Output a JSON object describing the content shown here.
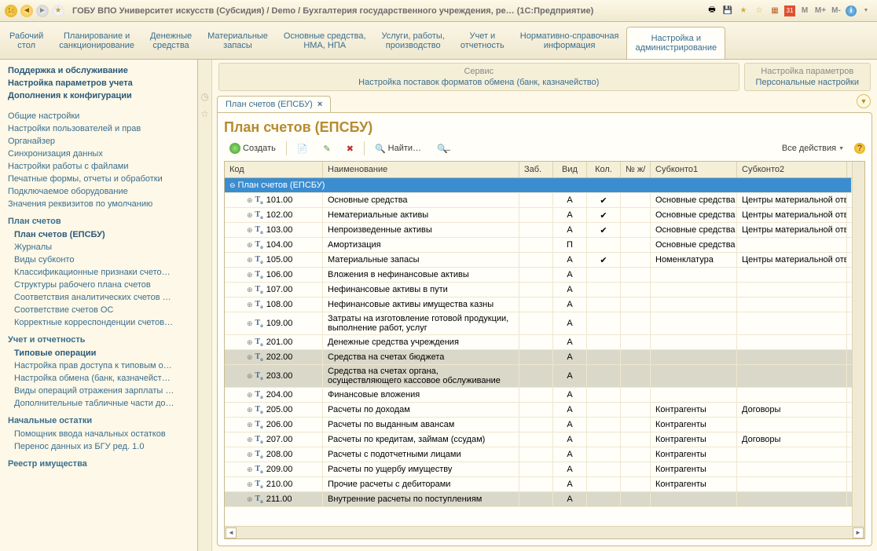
{
  "titlebar": {
    "text": "ГОБУ ВПО Университет искусств (Субсидия) / Demo / Бухгалтерия государственного учреждения, ре…   (1С:Предприятие)",
    "m_btns": [
      "M",
      "M+",
      "M-"
    ]
  },
  "main_tabs": [
    {
      "l1": "Рабочий",
      "l2": "стол"
    },
    {
      "l1": "Планирование и",
      "l2": "санкционирование"
    },
    {
      "l1": "Денежные",
      "l2": "средства"
    },
    {
      "l1": "Материальные",
      "l2": "запасы"
    },
    {
      "l1": "Основные средства,",
      "l2": "НМА, НПА"
    },
    {
      "l1": "Услуги, работы,",
      "l2": "производство"
    },
    {
      "l1": "Учет и",
      "l2": "отчетность"
    },
    {
      "l1": "Нормативно-справочная",
      "l2": "информация"
    },
    {
      "l1": "Настройка и",
      "l2": "администрирование",
      "active": true
    }
  ],
  "nav": {
    "groups": [
      {
        "title": null,
        "items": [
          {
            "t": "Поддержка и обслуживание",
            "bold": true,
            "plain": true
          },
          {
            "t": "Настройка параметров учета",
            "bold": true,
            "plain": true
          },
          {
            "t": "Дополнения к конфигурации",
            "bold": true,
            "plain": true
          }
        ]
      },
      {
        "title": null,
        "items": [
          {
            "t": "Общие настройки",
            "plain": true
          },
          {
            "t": "Настройки пользователей и прав",
            "plain": true
          },
          {
            "t": "Органайзер",
            "plain": true
          },
          {
            "t": "Синхронизация данных",
            "plain": true
          },
          {
            "t": "Настройки работы с файлами",
            "plain": true
          },
          {
            "t": "Печатные формы, отчеты и обработки",
            "plain": true
          },
          {
            "t": "Подключаемое оборудование",
            "plain": true
          },
          {
            "t": "Значения реквизитов по умолчанию",
            "plain": true
          }
        ]
      },
      {
        "title": "План счетов",
        "items": [
          {
            "t": "План счетов (ЕПСБУ)",
            "bold": true
          },
          {
            "t": "Журналы"
          },
          {
            "t": "Виды субконто"
          },
          {
            "t": "Классификационные признаки счето…"
          },
          {
            "t": "Структуры рабочего плана счетов"
          },
          {
            "t": "Соответствия аналитических счетов …"
          },
          {
            "t": "Соответствие счетов ОС"
          },
          {
            "t": "Корректные корреспонденции счетов…"
          }
        ]
      },
      {
        "title": "Учет и отчетность",
        "items": [
          {
            "t": "Типовые операции",
            "bold": true
          },
          {
            "t": "Настройка прав доступа к типовым о…"
          },
          {
            "t": "Настройка обмена (банк, казначейст…"
          },
          {
            "t": "Виды операций отражения зарплаты …"
          },
          {
            "t": "Дополнительные табличные части до…"
          }
        ]
      },
      {
        "title": "Начальные остатки",
        "items": [
          {
            "t": "Помощник ввода начальных остатков"
          },
          {
            "t": "Перенос данных из БГУ ред. 1.0"
          }
        ]
      },
      {
        "title": "Реестр имущества",
        "items": []
      }
    ]
  },
  "service": {
    "left_title": "Сервис",
    "left_link": "Настройка поставок форматов обмена (банк, казначейство)",
    "right_title": "Настройка параметров",
    "right_link": "Персональные настройки"
  },
  "doc_tab": "План счетов (ЕПСБУ)",
  "doc_title": "План счетов (ЕПСБУ)",
  "toolbar": {
    "create": "Создать",
    "find": "Найти…",
    "all_actions": "Все действия"
  },
  "grid": {
    "headers": [
      "Код",
      "Наименование",
      "Заб.",
      "Вид",
      "Кол.",
      "№ ж/",
      "Субконто1",
      "Субконто2"
    ],
    "root": "План счетов (ЕПСБУ)",
    "rows": [
      {
        "code": "101.00",
        "name": "Основные средства",
        "vid": "А",
        "kol": "✔",
        "s1": "Основные средства",
        "s2": "Центры материальной отве"
      },
      {
        "code": "102.00",
        "name": "Нематериальные активы",
        "vid": "А",
        "kol": "✔",
        "s1": "Основные средства",
        "s2": "Центры материальной отве"
      },
      {
        "code": "103.00",
        "name": "Непроизведенные активы",
        "vid": "А",
        "kol": "✔",
        "s1": "Основные средства",
        "s2": "Центры материальной отве"
      },
      {
        "code": "104.00",
        "name": "Амортизация",
        "vid": "П",
        "kol": "",
        "s1": "Основные средства",
        "s2": ""
      },
      {
        "code": "105.00",
        "name": "Материальные запасы",
        "vid": "А",
        "kol": "✔",
        "s1": "Номенклатура",
        "s2": "Центры материальной отве"
      },
      {
        "code": "106.00",
        "name": "Вложения в нефинансовые активы",
        "vid": "А",
        "kol": "",
        "s1": "",
        "s2": ""
      },
      {
        "code": "107.00",
        "name": "Нефинансовые активы в пути",
        "vid": "А",
        "kol": "",
        "s1": "",
        "s2": ""
      },
      {
        "code": "108.00",
        "name": "Нефинансовые активы имущества казны",
        "vid": "А",
        "kol": "",
        "s1": "",
        "s2": ""
      },
      {
        "code": "109.00",
        "name": "Затраты на изготовление готовой продукции, выполнение работ, услуг",
        "vid": "А",
        "kol": "",
        "s1": "",
        "s2": "",
        "tall": true
      },
      {
        "code": "201.00",
        "name": "Денежные средства учреждения",
        "vid": "А",
        "kol": "",
        "s1": "",
        "s2": ""
      },
      {
        "code": "202.00",
        "name": "Средства на счетах бюджета",
        "vid": "А",
        "kol": "",
        "s1": "",
        "s2": "",
        "stripe": true
      },
      {
        "code": "203.00",
        "name": "Средства на счетах органа, осуществляющего кассовое обслуживание",
        "vid": "А",
        "kol": "",
        "s1": "",
        "s2": "",
        "stripe": true,
        "tall": true
      },
      {
        "code": "204.00",
        "name": "Финансовые вложения",
        "vid": "А",
        "kol": "",
        "s1": "",
        "s2": ""
      },
      {
        "code": "205.00",
        "name": "Расчеты по доходам",
        "vid": "А",
        "kol": "",
        "s1": "Контрагенты",
        "s2": "Договоры"
      },
      {
        "code": "206.00",
        "name": "Расчеты по выданным авансам",
        "vid": "А",
        "kol": "",
        "s1": "Контрагенты",
        "s2": ""
      },
      {
        "code": "207.00",
        "name": "Расчеты по кредитам, займам (ссудам)",
        "vid": "А",
        "kol": "",
        "s1": "Контрагенты",
        "s2": "Договоры"
      },
      {
        "code": "208.00",
        "name": "Расчеты с подотчетными лицами",
        "vid": "А",
        "kol": "",
        "s1": "Контрагенты",
        "s2": ""
      },
      {
        "code": "209.00",
        "name": "Расчеты по ущербу имуществу",
        "vid": "А",
        "kol": "",
        "s1": "Контрагенты",
        "s2": ""
      },
      {
        "code": "210.00",
        "name": "Прочие расчеты с дебиторами",
        "vid": "А",
        "kol": "",
        "s1": "Контрагенты",
        "s2": ""
      },
      {
        "code": "211.00",
        "name": "Внутренние расчеты по поступлениям",
        "vid": "А",
        "kol": "",
        "s1": "",
        "s2": "",
        "stripe": true
      }
    ]
  }
}
